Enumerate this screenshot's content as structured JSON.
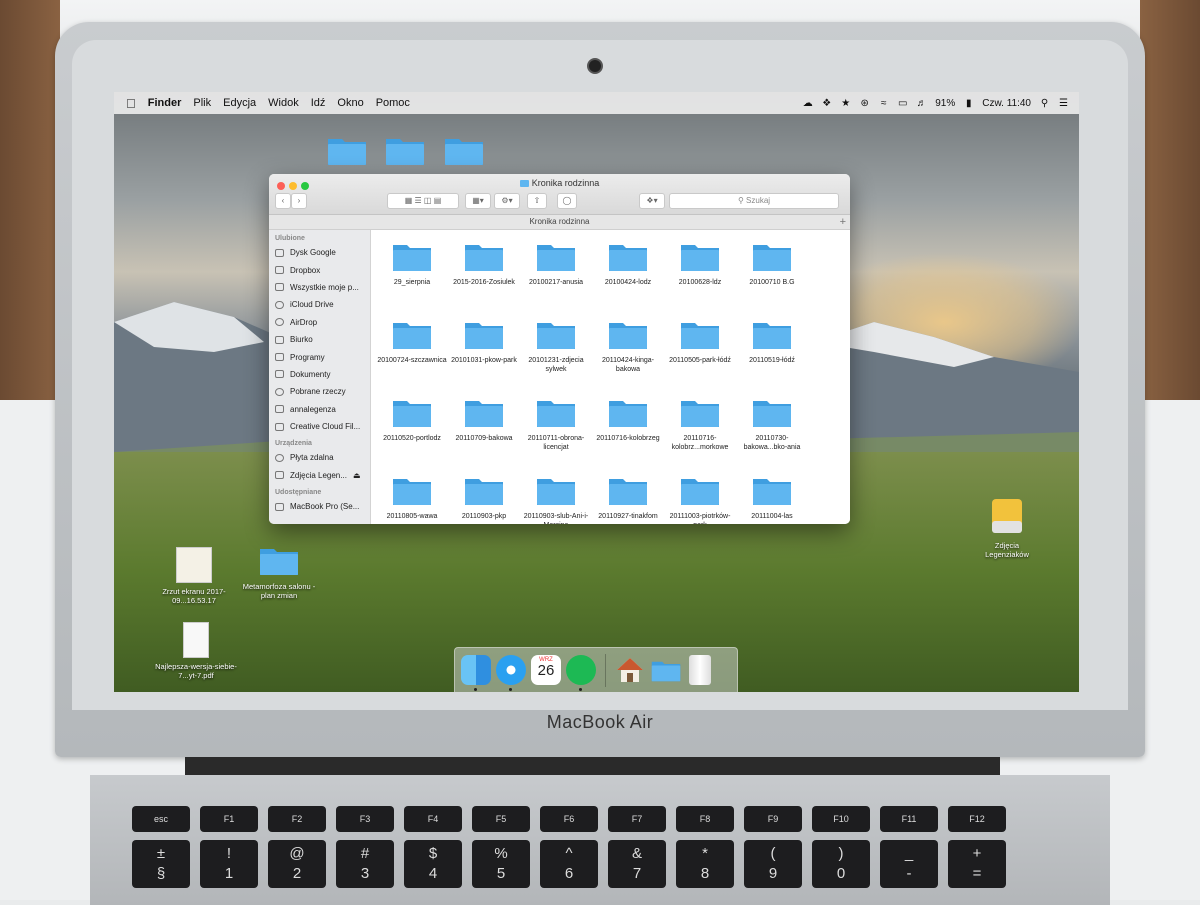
{
  "laptop": {
    "brand": "MacBook Air"
  },
  "menubar": {
    "apple_icon": "apple-logo-icon",
    "items": [
      "Finder",
      "Plik",
      "Edycja",
      "Widok",
      "Idź",
      "Okno",
      "Pomoc"
    ],
    "battery_percent": "91%",
    "clock": "Czw. 11:40",
    "status_icons": [
      "creative-cloud-icon",
      "dropbox-icon",
      "evernote-icon",
      "wifi-icon",
      "airplay-icon",
      "volume-icon",
      "battery-icon",
      "search-icon",
      "list-icon"
    ]
  },
  "finder": {
    "title": "Kronika rodzinna",
    "path_label": "Kronika rodzinna",
    "search_placeholder": "Szukaj",
    "sidebar": {
      "favorites_head": "Ulubione",
      "favorites": [
        "Dysk Google",
        "Dropbox",
        "Wszystkie moje p...",
        "iCloud Drive",
        "AirDrop",
        "Biurko",
        "Programy",
        "Dokumenty",
        "Pobrane rzeczy",
        "annalegenza",
        "Creative Cloud Fil..."
      ],
      "devices_head": "Urządzenia",
      "devices": [
        "Płyta zdalna",
        "Zdjęcia Legen..."
      ],
      "shared_head": "Udostępniane",
      "shared": [
        "MacBook Pro (Se..."
      ]
    },
    "folders": [
      "29_sierpnia",
      "2015-2016-Zosiulek",
      "20100217-anusia",
      "20100424-lodz",
      "20100628-ldz",
      "20100710 B.G",
      "20100724-szczawnica",
      "20101031-pkow-park",
      "20101231-zdjecia sylwek",
      "20110424-kinga-bakowa",
      "20110505-park-łódź",
      "20110519-łódź",
      "20110520-portlodz",
      "20110709-bakowa",
      "20110711-obrona-licencjat",
      "20110716-kolobrzeg",
      "20110716-kolobrz...morkowe",
      "20110730-bakowa...bko-ania",
      "20110805-wawa",
      "20110903-pkp",
      "20110903-slub-Ani-i-Marcina",
      "20110927-tinakfom",
      "20111003-piotrków-park",
      "20111004-las"
    ]
  },
  "desktop": {
    "items": [
      {
        "label": "Zrzut ekranu 2017-09...16.53.17",
        "icon": "screenshot-thumbnail-icon"
      },
      {
        "label": "Metamorfoza salonu - plan zmian",
        "icon": "folder-icon"
      },
      {
        "label": "Najlepsza-wersja-siebie-7...yt-7.pdf",
        "icon": "pdf-thumbnail-icon"
      },
      {
        "label": "Zdjęcia Legenziaków",
        "icon": "external-drive-icon"
      }
    ]
  },
  "dock": {
    "items": [
      "finder-icon",
      "safari-icon",
      "calendar-icon",
      "spotify-icon",
      "home-folder-icon",
      "folder-icon",
      "trash-icon"
    ],
    "calendar_day": "26",
    "calendar_month": "WRZ"
  },
  "keyboard": {
    "fn_row": [
      "esc",
      "F1",
      "F2",
      "F3",
      "F4",
      "F5",
      "F6",
      "F7",
      "F8",
      "F9",
      "F10",
      "F11",
      "F12"
    ],
    "num_row_top": [
      "±",
      "!",
      "@",
      "#",
      "$",
      "%",
      "^",
      "&",
      "*",
      "(",
      ")",
      "_",
      "+"
    ],
    "num_row_bottom": [
      "§",
      "1",
      "2",
      "3",
      "4",
      "5",
      "6",
      "7",
      "8",
      "9",
      "0",
      "-",
      "="
    ]
  },
  "colors": {
    "folder_blue": "#5fb6f0",
    "folder_blue_dark": "#3f9ee0",
    "menubar_bg": "#ececec"
  }
}
